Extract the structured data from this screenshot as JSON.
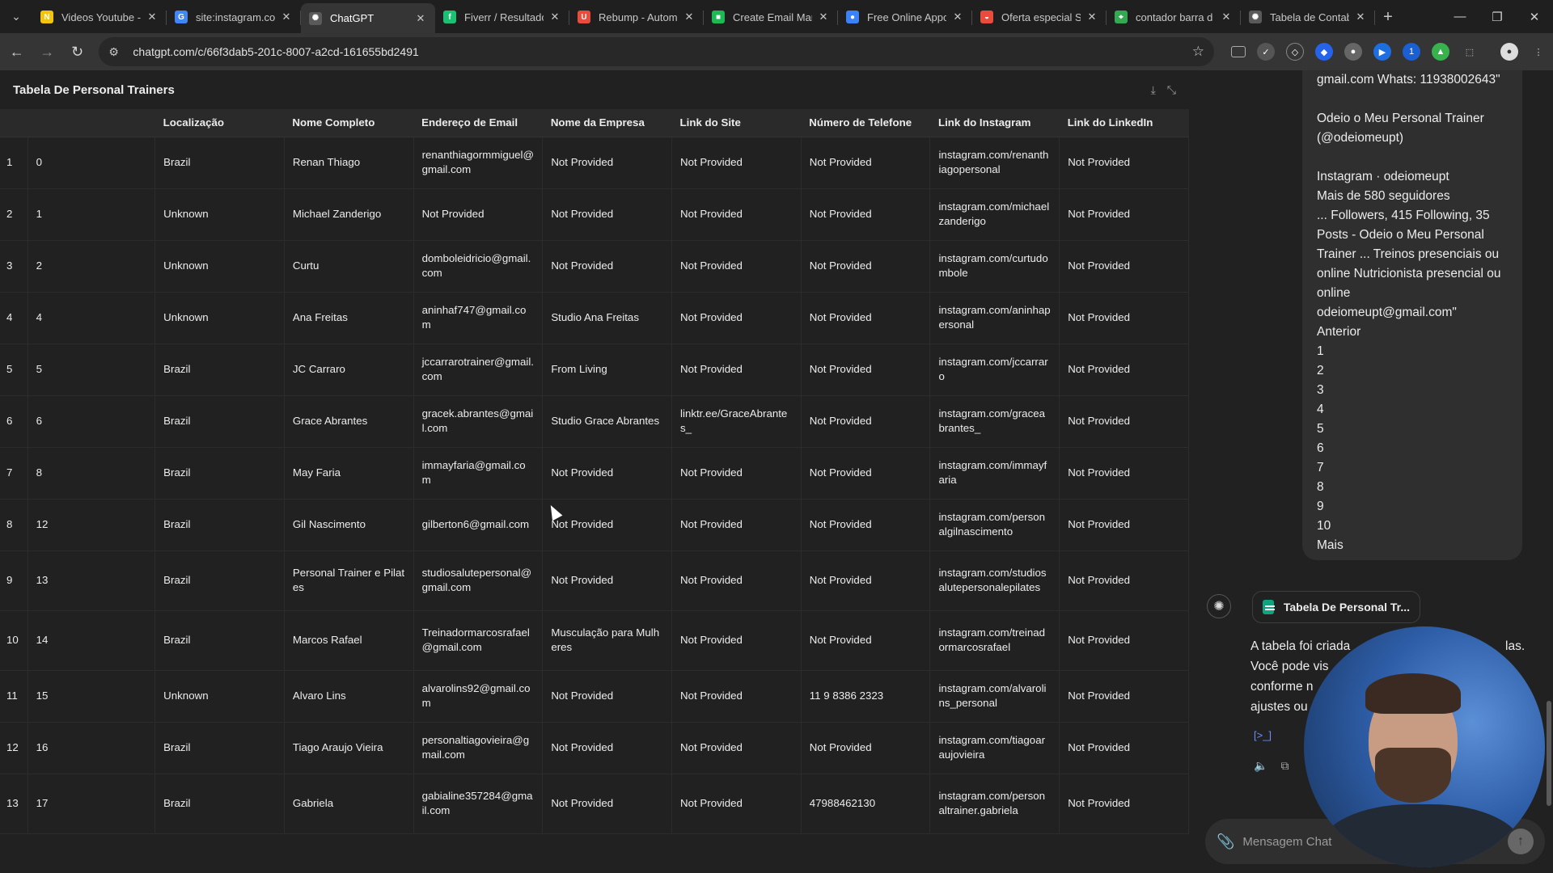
{
  "browser": {
    "tabs": [
      {
        "label": "Videos Youtube -",
        "icon": "notion-icon",
        "color": "#f1c40f",
        "glyph": "N",
        "active": false
      },
      {
        "label": "site:instagram.con",
        "icon": "google-icon",
        "color": "#4285f4",
        "glyph": "G",
        "active": false
      },
      {
        "label": "ChatGPT",
        "icon": "openai-icon",
        "color": "#5a5a5a",
        "glyph": "✺",
        "active": true
      },
      {
        "label": "Fiverr / Resultado",
        "icon": "fiverr-icon",
        "color": "#1dbf73",
        "glyph": "f",
        "active": false
      },
      {
        "label": "Rebump - Autom",
        "icon": "rebump-icon",
        "color": "#e74c3c",
        "glyph": "U",
        "active": false
      },
      {
        "label": "Create Email Mar",
        "icon": "chat-icon",
        "color": "#1db954",
        "glyph": "■",
        "active": false
      },
      {
        "label": "Free Online Appo",
        "icon": "globe-icon",
        "color": "#3b82f6",
        "glyph": "●",
        "active": false
      },
      {
        "label": "Oferta especial Sc",
        "icon": "offer-icon",
        "color": "#e74c3c",
        "glyph": "◒",
        "active": false
      },
      {
        "label": "contador barra d",
        "icon": "maps-icon",
        "color": "#34a853",
        "glyph": "⌖",
        "active": false
      },
      {
        "label": "Tabela de Contab",
        "icon": "openai-icon",
        "color": "#5a5a5a",
        "glyph": "✺",
        "active": false
      }
    ],
    "url": "chatgpt.com/c/66f3dab5-201c-8007-a2cd-161655bd2491"
  },
  "panel": {
    "title": "Tabela De Personal Trainers"
  },
  "table": {
    "columns": [
      "Localização",
      "Nome Completo",
      "Endereço de Email",
      "Nome da Empresa",
      "Link do Site",
      "Número de Telefone",
      "Link do Instagram",
      "Link do LinkedIn"
    ],
    "rows": [
      {
        "n": "1",
        "idx": "0",
        "cells": [
          "Brazil",
          "Renan Thiago",
          "renanthiagormmiguel@gmail.com",
          "Not Provided",
          "Not Provided",
          "Not Provided",
          "instagram.com/renanthiagopersonal",
          "Not Provided"
        ]
      },
      {
        "n": "2",
        "idx": "1",
        "cells": [
          "Unknown",
          "Michael Zanderigo",
          "Not Provided",
          "Not Provided",
          "Not Provided",
          "Not Provided",
          "instagram.com/michaelzanderigo",
          "Not Provided"
        ]
      },
      {
        "n": "3",
        "idx": "2",
        "cells": [
          "Unknown",
          "Curtu",
          "domboleidricio@gmail.com",
          "Not Provided",
          "Not Provided",
          "Not Provided",
          "instagram.com/curtudombole",
          "Not Provided"
        ]
      },
      {
        "n": "4",
        "idx": "4",
        "cells": [
          "Unknown",
          "Ana Freitas",
          "aninhaf747@gmail.com",
          "Studio Ana Freitas",
          "Not Provided",
          "Not Provided",
          "instagram.com/aninhapersonal",
          "Not Provided"
        ]
      },
      {
        "n": "5",
        "idx": "5",
        "cells": [
          "Brazil",
          "JC Carraro",
          "jccarrarotrainer@gmail.com",
          "From Living",
          "Not Provided",
          "Not Provided",
          "instagram.com/jccarraro",
          "Not Provided"
        ]
      },
      {
        "n": "6",
        "idx": "6",
        "cells": [
          "Brazil",
          "Grace Abrantes",
          "gracek.abrantes@gmail.com",
          "Studio Grace Abrantes",
          "linktr.ee/GraceAbrantes_",
          "Not Provided",
          "instagram.com/graceabrantes_",
          "Not Provided"
        ]
      },
      {
        "n": "7",
        "idx": "8",
        "cells": [
          "Brazil",
          "May Faria",
          "immayfaria@gmail.com",
          "Not Provided",
          "Not Provided",
          "Not Provided",
          "instagram.com/immayfaria",
          "Not Provided"
        ]
      },
      {
        "n": "8",
        "idx": "12",
        "cells": [
          "Brazil",
          "Gil Nascimento",
          "gilberton6@gmail.com",
          "Not Provided",
          "Not Provided",
          "Not Provided",
          "instagram.com/personalgilnascimento",
          "Not Provided"
        ]
      },
      {
        "n": "9",
        "idx": "13",
        "cells": [
          "Brazil",
          "Personal Trainer e Pilates",
          "studiosalutepersonal@gmail.com",
          "Not Provided",
          "Not Provided",
          "Not Provided",
          "instagram.com/studiosalutepersonalepilates",
          "Not Provided"
        ]
      },
      {
        "n": "10",
        "idx": "14",
        "cells": [
          "Brazil",
          "Marcos Rafael",
          "Treinadormarcosrafael@gmail.com",
          "Musculação para Mulheres",
          "Not Provided",
          "Not Provided",
          "instagram.com/treinadormarcosrafael",
          "Not Provided"
        ]
      },
      {
        "n": "11",
        "idx": "15",
        "cells": [
          "Unknown",
          "Alvaro Lins",
          "alvarolins92@gmail.com",
          "Not Provided",
          "Not Provided",
          "11 9 8386 2323",
          "instagram.com/alvarolins_personal",
          "Not Provided"
        ]
      },
      {
        "n": "12",
        "idx": "16",
        "cells": [
          "Brazil",
          "Tiago Araujo Vieira",
          "personaltiagovieira@gmail.com",
          "Not Provided",
          "Not Provided",
          "Not Provided",
          "instagram.com/tiagoaraujovieira",
          "Not Provided"
        ]
      },
      {
        "n": "13",
        "idx": "17",
        "cells": [
          "Brazil",
          "Gabriela",
          "gabialine357284@gmail.com",
          "Not Provided",
          "Not Provided",
          "47988462130",
          "instagram.com/personaltrainer.gabriela",
          "Not Provided"
        ]
      }
    ]
  },
  "chat": {
    "bubble_text": "gmail.com Whats: 11938002643\"\n\nOdeio o Meu Personal Trainer (@odeiomeupt)\n\nInstagram · odeiomeupt\nMais de 580 seguidores\n... Followers, 415 Following, 35 Posts - Odeio o Meu Personal Trainer ... Treinos presenciais ou online Nutricionista presencial ou online\nodeiomeupt@gmail.com\"\nAnterior\n1\n2\n3\n4\n5\n6\n7\n8\n9\n10\nMais",
    "doc_chip": "Tabela De Personal Tr...",
    "reply_lines": [
      "A tabela foi criada",
      "Você pode vis",
      "conforme n",
      "ajustes ou"
    ],
    "reply_tail": "las.",
    "composer_placeholder": "Mensagem Chat"
  }
}
